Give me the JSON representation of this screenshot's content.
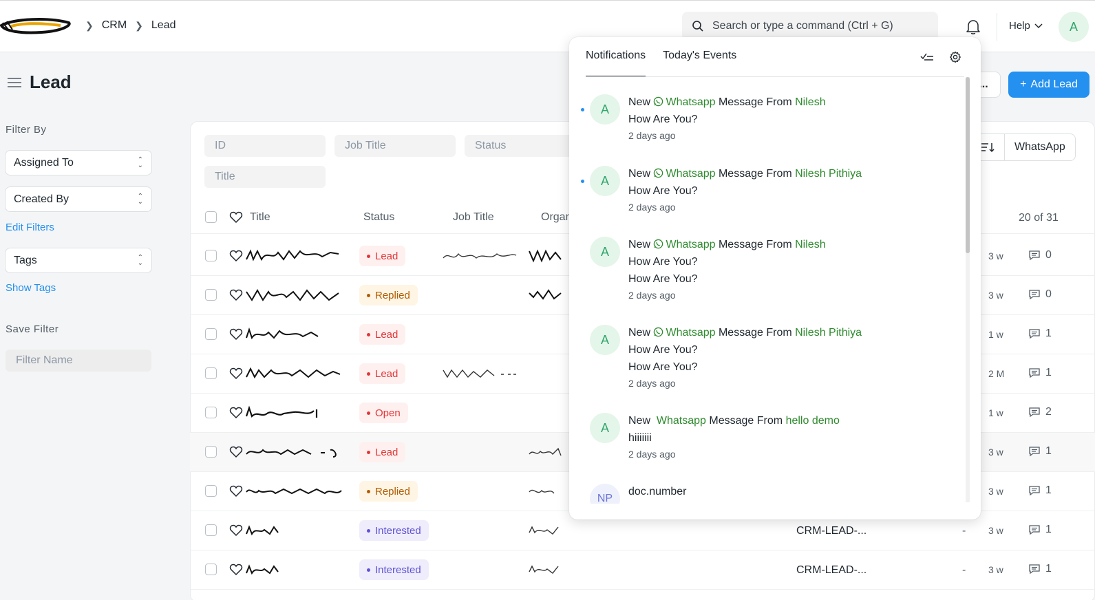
{
  "breadcrumb": [
    "CRM",
    "Lead"
  ],
  "search": {
    "placeholder": "Search or type a command (Ctrl + G)"
  },
  "help_label": "Help",
  "user_avatar_letter": "A",
  "page": {
    "title": "Lead",
    "more_label": "...",
    "add_button": "Add Lead"
  },
  "sidebar": {
    "filter_by": "Filter By",
    "assigned_to": "Assigned To",
    "created_by": "Created By",
    "edit_filters": "Edit Filters",
    "tags": "Tags",
    "show_tags": "Show Tags",
    "save_filter": "Save Filter",
    "filter_name_placeholder": "Filter Name"
  },
  "filters": {
    "id": "ID",
    "job_title": "Job Title",
    "status": "Status",
    "title": "Title"
  },
  "view_buttons": {
    "whatsapp": "WhatsApp"
  },
  "table": {
    "headers": {
      "title": "Title",
      "status": "Status",
      "job_title": "Job Title",
      "organization": "Organ"
    },
    "count": "20 of 31",
    "rows": [
      {
        "status": "Lead",
        "crm_id": "",
        "dash": "",
        "age": "3 w",
        "comments": "0"
      },
      {
        "status": "Replied",
        "crm_id": "",
        "dash": "",
        "age": "3 w",
        "comments": "0"
      },
      {
        "status": "Lead",
        "crm_id": "",
        "dash": "",
        "age": "1 w",
        "comments": "1"
      },
      {
        "status": "Lead",
        "crm_id": "",
        "dash": "",
        "age": "2 M",
        "comments": "1"
      },
      {
        "status": "Open",
        "crm_id": "",
        "dash": "",
        "age": "1 w",
        "comments": "2"
      },
      {
        "status": "Lead",
        "crm_id": "",
        "dash": "",
        "age": "3 w",
        "comments": "1"
      },
      {
        "status": "Replied",
        "crm_id": "",
        "dash": "",
        "age": "3 w",
        "comments": "1"
      },
      {
        "status": "Interested",
        "crm_id": "CRM-LEAD-...",
        "dash": "-",
        "age": "3 w",
        "comments": "1"
      },
      {
        "status": "Interested",
        "crm_id": "CRM-LEAD-...",
        "dash": "-",
        "age": "3 w",
        "comments": "1"
      }
    ]
  },
  "notifications": {
    "tabs": [
      "Notifications",
      "Today's Events"
    ],
    "items": [
      {
        "avatar": "A",
        "prefix": "New",
        "app": "Whatsapp",
        "middle": "Message From",
        "sender": "Nilesh",
        "lines": [
          "How Are You?"
        ],
        "time": "2 days ago",
        "unread": true
      },
      {
        "avatar": "A",
        "prefix": "New",
        "app": "Whatsapp",
        "middle": "Message From",
        "sender": "Nilesh Pithiya",
        "lines": [
          "How Are You?"
        ],
        "time": "2 days ago",
        "unread": true
      },
      {
        "avatar": "A",
        "prefix": "New",
        "app": "Whatsapp",
        "middle": "Message From",
        "sender": "Nilesh",
        "lines": [
          "How Are You?",
          "How Are You?"
        ],
        "time": "2 days ago",
        "unread": false
      },
      {
        "avatar": "A",
        "prefix": "New",
        "app": "Whatsapp",
        "middle": "Message From",
        "sender": "Nilesh Pithiya",
        "lines": [
          "How Are You?",
          "How Are You?"
        ],
        "time": "2 days ago",
        "unread": false
      },
      {
        "avatar": "A",
        "prefix": "New",
        "app": "Whatsapp",
        "middle": "Message From",
        "sender": "hello demo",
        "lines": [
          "hiiiiiii"
        ],
        "time": "2 days ago",
        "unread": false
      },
      {
        "avatar": "NP",
        "prefix": "doc.number",
        "app": "",
        "middle": "",
        "sender": "",
        "lines": [],
        "time": "",
        "unread": false
      }
    ]
  },
  "colors": {
    "primary": "#2490ef",
    "whatsapp_green": "#2d8a2d",
    "lead_red": "#e03636",
    "replied_orange": "#b15c00",
    "interested_purple": "#5e52d6"
  }
}
